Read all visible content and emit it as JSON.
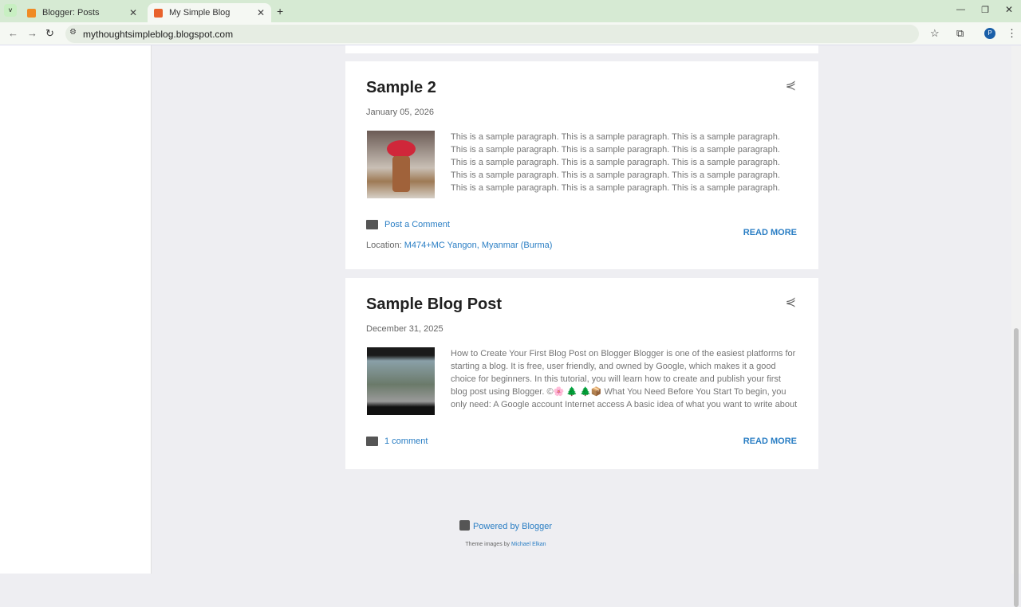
{
  "browser": {
    "tabs": [
      {
        "label": "Blogger: Posts"
      },
      {
        "label": "My Simple Blog"
      }
    ],
    "url": "mythoughtsimpleblog.blogspot.com",
    "profile": "P"
  },
  "posts": [
    {
      "title": "Sample 2",
      "date": "January 05, 2026",
      "excerpt": "This is a sample paragraph.  This is a sample paragraph.  This is a sample paragraph.  This is a sample paragraph.  This is a sample paragraph.  This is a sample paragraph.  This is a sample paragraph.  This is a sample paragraph.  This is a sample paragraph.  This is a sample paragraph.  This is a sample paragraph.  This is a sample paragraph.  This is a sample paragraph.  This is a sample paragraph.  This is a sample paragraph.  This is a sample …",
      "comment_label": "Post a Comment",
      "location_label": "Location:",
      "location": "M474+MC Yangon, Myanmar (Burma)",
      "read_more": "READ MORE"
    },
    {
      "title": "Sample Blog Post",
      "date": "December 31, 2025",
      "excerpt": "  How to Create Your First Blog Post on Blogger Blogger is one of the easiest platforms for starting a blog. It is free, user friendly, and owned by Google, which makes it a good choice for beginners. In this tutorial, you will learn how to create and publish your first blog post using Blogger. ©🌸 🌲 🌲📦 What You Need Before You Start To begin, you only need: A Google account Internet access A basic idea of what you want to write about Once you are signed in …",
      "comment_label": "1 comment",
      "read_more": "READ MORE"
    }
  ],
  "footer": {
    "powered": "Powered by Blogger",
    "theme_prefix": "Theme images by",
    "theme_author": "Michael Elkan"
  }
}
